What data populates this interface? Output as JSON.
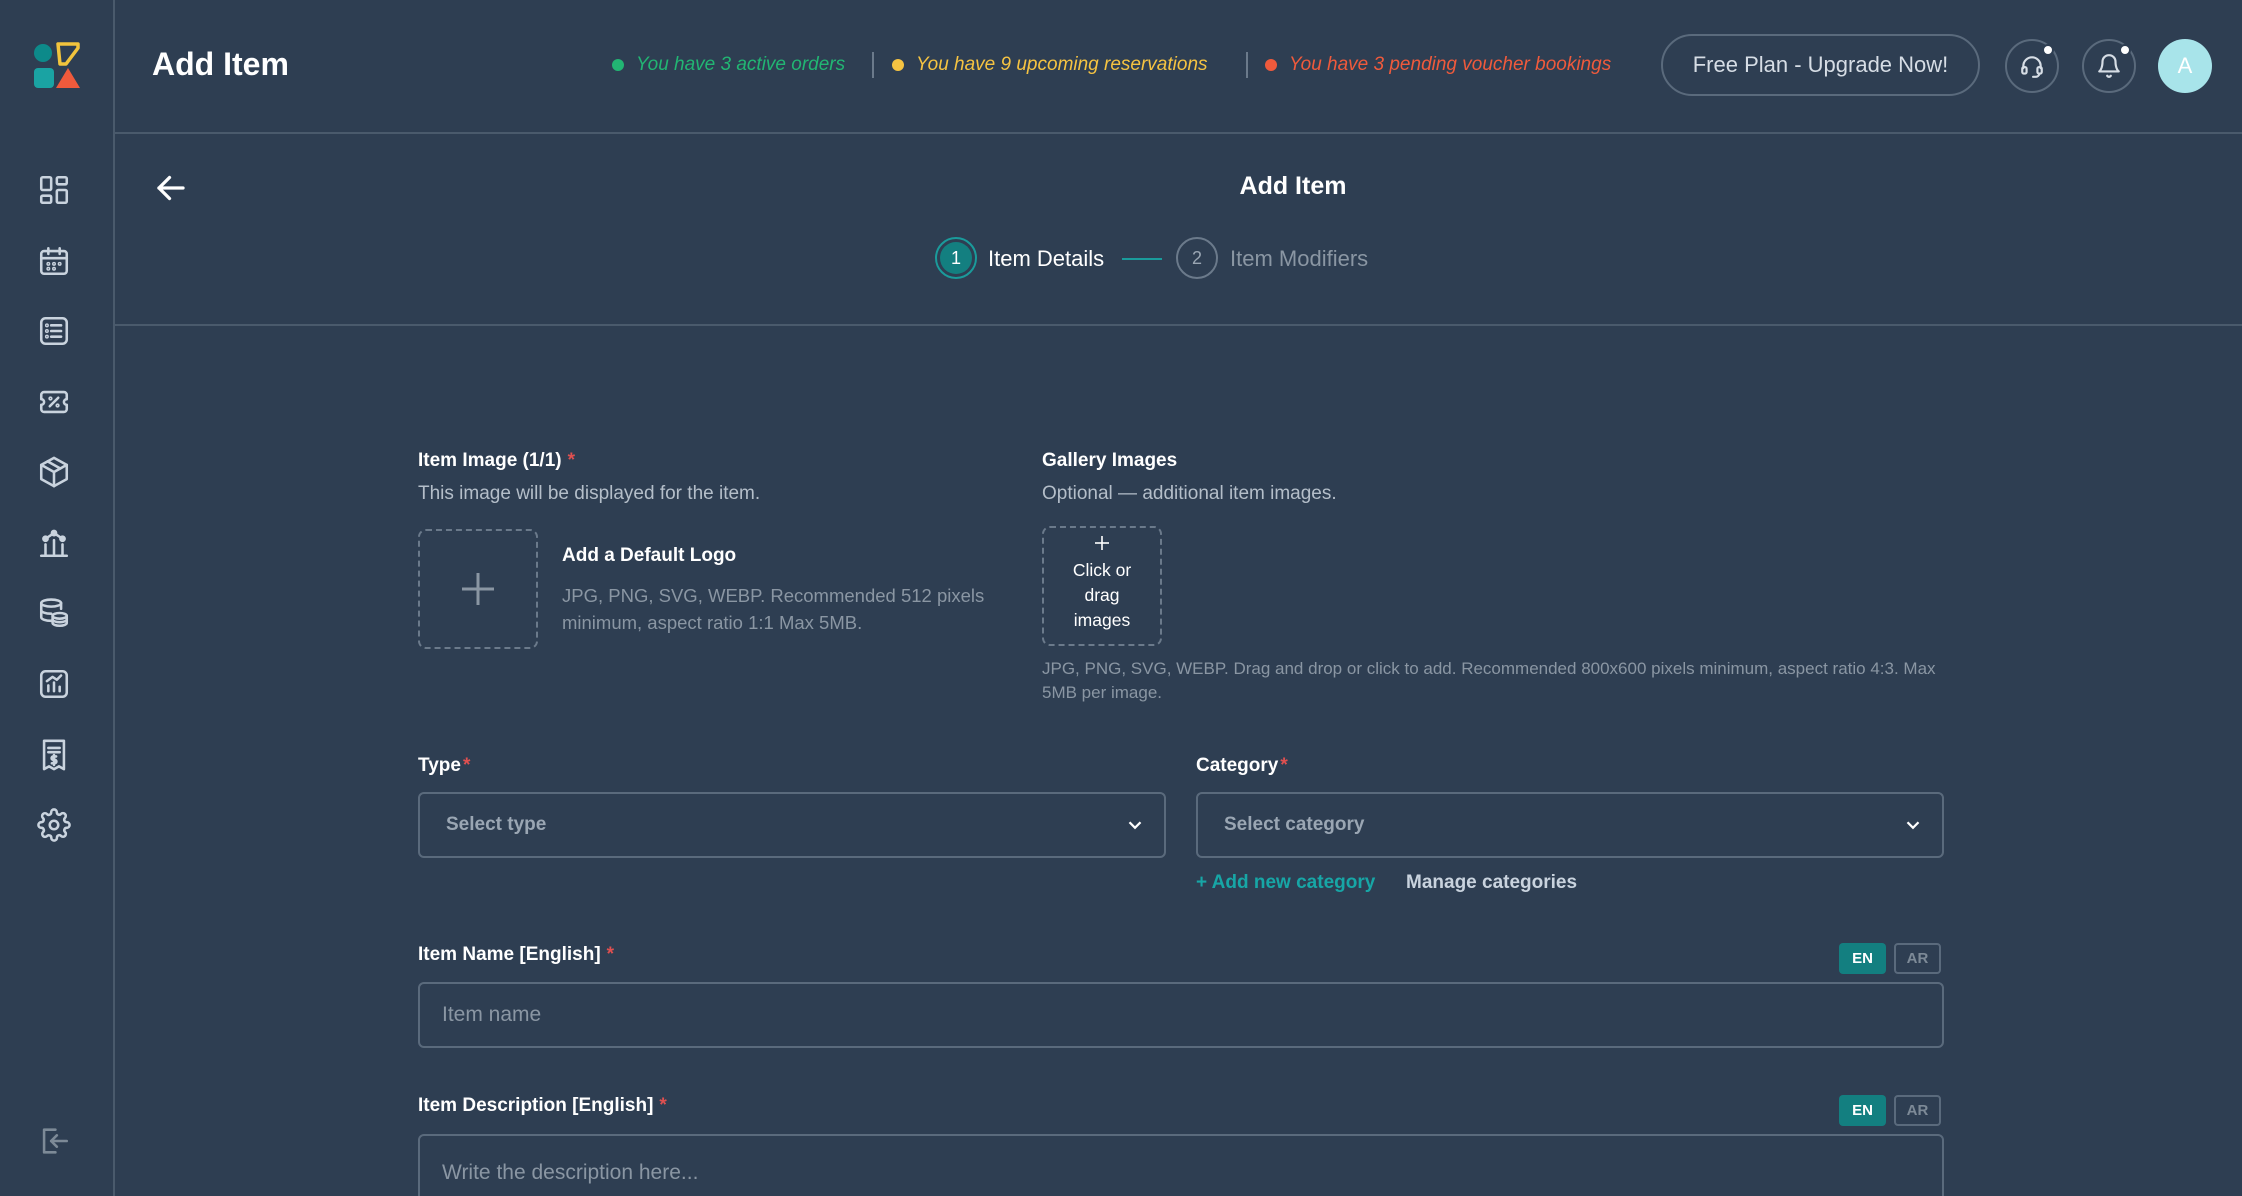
{
  "header": {
    "title": "Add Item",
    "status": [
      {
        "text": "You have 3 active orders",
        "color": "#22b573"
      },
      {
        "text": "You have 9 upcoming reservations",
        "color": "#f5c342"
      },
      {
        "text": "You have 3 pending voucher bookings",
        "color": "#ef5a3c"
      }
    ],
    "upgrade_label": "Free Plan - Upgrade Now!",
    "avatar_initial": "A"
  },
  "sidebar": {
    "items": [
      "dashboard-icon",
      "calendar-icon",
      "list-icon",
      "voucher-icon",
      "box-icon",
      "chart-people-icon",
      "database-icon",
      "analytics-icon",
      "receipt-icon",
      "settings-icon"
    ],
    "logout": "logout-icon"
  },
  "page": {
    "title": "Add Item",
    "steps": [
      {
        "number": "1",
        "label": "Item Details",
        "active": true
      },
      {
        "number": "2",
        "label": "Item Modifiers",
        "active": false
      }
    ]
  },
  "form": {
    "item_image": {
      "label": "Item Image (1/1)",
      "required": "*",
      "hint": "This image will be displayed for the item.",
      "upload_title": "Add a Default Logo",
      "upload_hint": "JPG, PNG, SVG, WEBP. Recommended 512 pixels minimum, aspect ratio 1:1 Max 5MB."
    },
    "gallery": {
      "label": "Gallery Images",
      "hint": "Optional — additional item images.",
      "box_text": "Click or drag images",
      "note": "JPG, PNG, SVG, WEBP. Drag and drop or click to add. Recommended 800x600 pixels minimum, aspect ratio 4:3. Max 5MB per image."
    },
    "type": {
      "label": "Type",
      "required": "*",
      "placeholder": "Select type"
    },
    "category": {
      "label": "Category",
      "required": "*",
      "placeholder": "Select category",
      "add_link": "+ Add new category",
      "manage_link": "Manage categories"
    },
    "item_name": {
      "label": "Item Name [English]",
      "required": "*",
      "placeholder": "Item name",
      "lang_en": "EN",
      "lang_ar": "AR"
    },
    "item_description": {
      "label": "Item Description [English]",
      "required": "*",
      "placeholder": "Write the description here...",
      "lang_en": "EN",
      "lang_ar": "AR"
    }
  },
  "colors": {
    "accent": "#137f80",
    "background": "#2e3e52",
    "required": "#e05050"
  }
}
